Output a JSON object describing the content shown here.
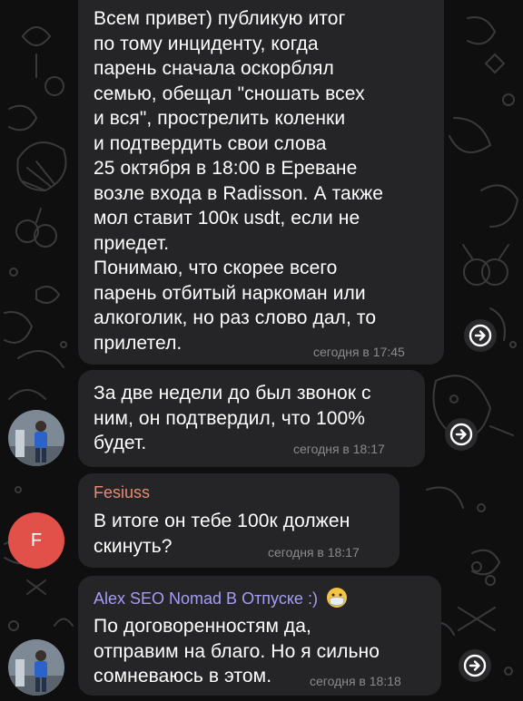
{
  "messages": [
    {
      "text": "Всем привет) публикую итог\nпо тому инциденту, когда\nпарень сначала оскорблял\nсемью, обещал \"сношать всех\nи вся\", прострелить коленки\nи подтвердить свои слова\n25 октября в 18:00 в Ереване\nвозле входа в Radisson. А также\nмол ставит 100к usdt, если не\nприедет.\nПонимаю, что скорее всего\nпарень отбитый наркоман или\nалкоголик, но раз слово дал, то\nприлетел.",
      "time": "сегодня в 17:45"
    },
    {
      "text": "За две недели до был звонок с\nним, он подтвердил, что 100%\nбудет.",
      "time": "сегодня в 18:17"
    },
    {
      "sender": "Fesiuss",
      "avatar_letter": "F",
      "text": "В итоге он тебе 100к должен\nскинуть?",
      "time": "сегодня в 18:17"
    },
    {
      "sender": "Alex SEO Nomad В Отпуске :)",
      "text": "По договоренностям да,\nотправим на благо. Но я сильно\nсомневаюсь в этом.",
      "time": "сегодня в 18:18"
    }
  ],
  "colors": {
    "fesiuss_name": "#e98a74",
    "alex_name": "#a79cf4",
    "avatar_f": "#e2504a",
    "bubble": "#252527",
    "background": "#0f0f10"
  },
  "icons": {
    "forward": "forward-arrow-icon",
    "emoji": "mask-face-emoji-icon"
  }
}
